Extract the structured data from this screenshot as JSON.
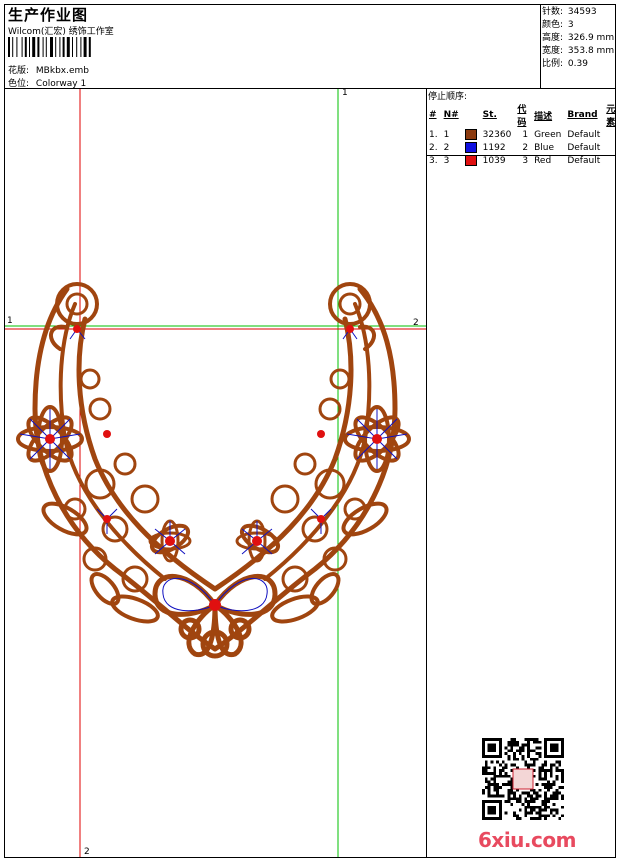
{
  "header": {
    "title": "生产作业图",
    "company": "Wilcom(汇宏) 绣饰工作室",
    "design_label": "花版:",
    "design_value": "MBkbx.emb",
    "colorway_label": "色位:",
    "colorway_value": "Colorway 1"
  },
  "stats": [
    {
      "label": "针数:",
      "value": "34593"
    },
    {
      "label": "颜色:",
      "value": "3"
    },
    {
      "label": "高度:",
      "value": "326.9 mm"
    },
    {
      "label": "宽度:",
      "value": "353.8 mm"
    },
    {
      "label": "比例:",
      "value": "0.39"
    }
  ],
  "stop_sequence": {
    "title": "停止顺序:",
    "headers": [
      "#",
      "N#",
      "St.",
      "代码",
      "描述",
      "Brand",
      "元素"
    ],
    "rows": [
      {
        "num": "1.",
        "n": "1",
        "color": "#8B3A0F",
        "st": "32360",
        "code": "1",
        "desc": "Green",
        "brand": "Default"
      },
      {
        "num": "2.",
        "n": "2",
        "color": "#1010E0",
        "st": "1192",
        "code": "2",
        "desc": "Blue",
        "brand": "Default"
      },
      {
        "num": "3.",
        "n": "3",
        "color": "#E01010",
        "st": "1039",
        "code": "3",
        "desc": "Red",
        "brand": "Default"
      }
    ]
  },
  "markers": {
    "top_green": "1",
    "bottom_red": "2",
    "left_h": "1",
    "right_h": "2"
  },
  "colors": {
    "thread_main": "#A0450F",
    "thread_blue": "#1010C0",
    "thread_red": "#E01010",
    "guide_red": "#E00000",
    "guide_green": "#00C000"
  },
  "watermark": "6xiu.com"
}
